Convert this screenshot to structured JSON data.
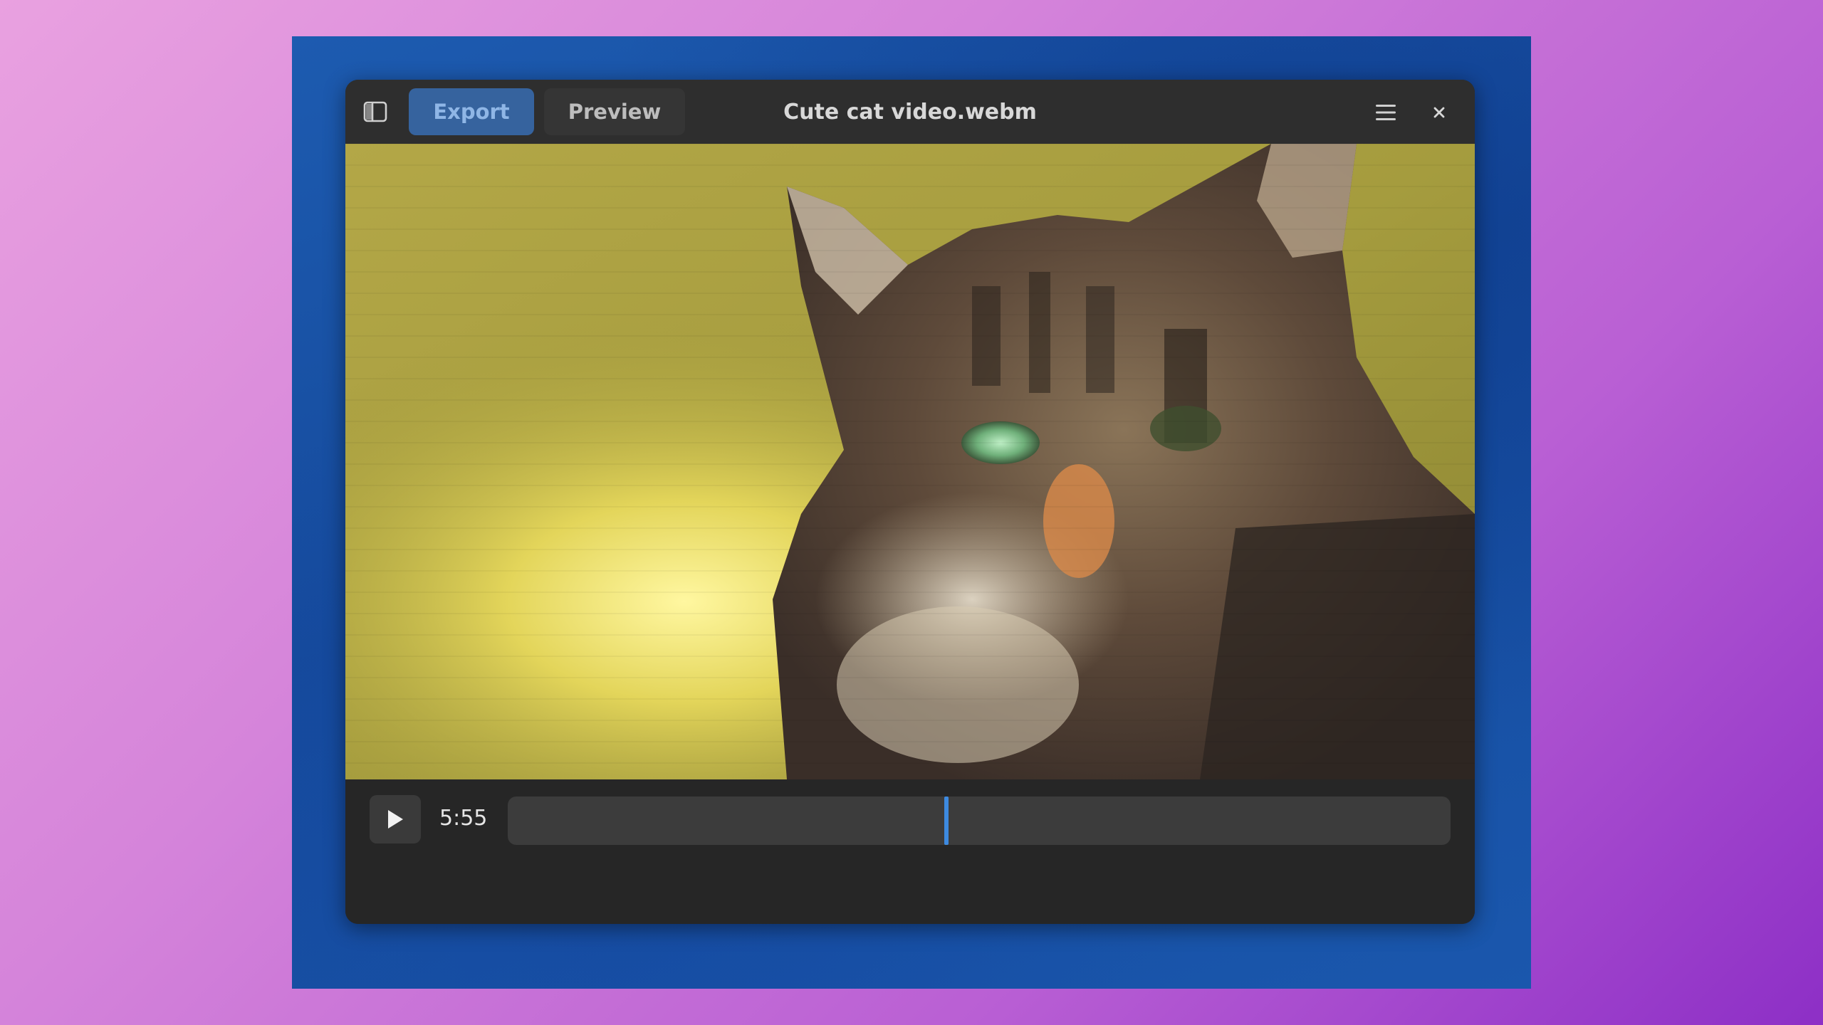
{
  "window": {
    "title": "Cute cat video.webm"
  },
  "header": {
    "export_label": "Export",
    "preview_label": "Preview",
    "icons": {
      "sidebar_toggle": "sidebar-toggle-icon",
      "menu": "hamburger-menu-icon",
      "close": "close-icon"
    }
  },
  "player": {
    "time": "5:55",
    "play_icon": "play-icon",
    "progress_fraction": 0.465
  },
  "colors": {
    "accent": "#3d8ae0",
    "export_bg": "#36639e",
    "export_text": "#8fb6e6"
  }
}
